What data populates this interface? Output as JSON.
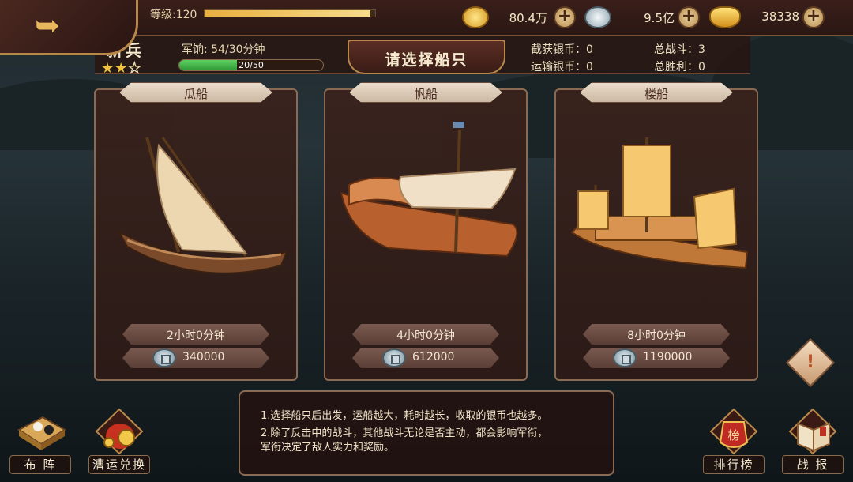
{
  "top": {
    "level_label": "等级:120",
    "level_progress": 0.97,
    "currencies": [
      {
        "icon": "gold-coins-icon",
        "value": "80.4万"
      },
      {
        "icon": "silver-coin-icon",
        "value": "9.5亿"
      },
      {
        "icon": "gold-ingot-icon",
        "value": "38338"
      }
    ]
  },
  "player": {
    "rank": "新兵",
    "stars_filled": 2,
    "stars_total": 3,
    "pay_label": "军饷: 54/30分钟",
    "pay_progress_text": "20/50",
    "pay_progress": 0.4
  },
  "title": "请选择船只",
  "stats": {
    "captured_silver": "截获银币：0",
    "transport_silver": "运输银币：0",
    "total_battles": "总战斗：3",
    "total_wins": "总胜利：0"
  },
  "ships": [
    {
      "name": "瓜船",
      "time": "2小时0分钟",
      "cost": "340000"
    },
    {
      "name": "帆船",
      "time": "4小时0分钟",
      "cost": "612000"
    },
    {
      "name": "楼船",
      "time": "8小时0分钟",
      "cost": "1190000"
    }
  ],
  "notice": {
    "line1": "1.选择船只后出发，运船越大，耗时越长，收取的银币也越多。",
    "line2": "2.除了反击中的战斗，其他战斗无论是否主动，都会影响军衔，",
    "line3": "军衔决定了敌人实力和奖励。"
  },
  "bottom_buttons": {
    "formation": "布 阵",
    "exchange": "漕运兑换",
    "ranking": "排行榜",
    "report": "战 报"
  },
  "colors": {
    "accent_gold": "#e8b040",
    "panel_border": "#8a6a52",
    "pay_green": "#3eb444"
  }
}
